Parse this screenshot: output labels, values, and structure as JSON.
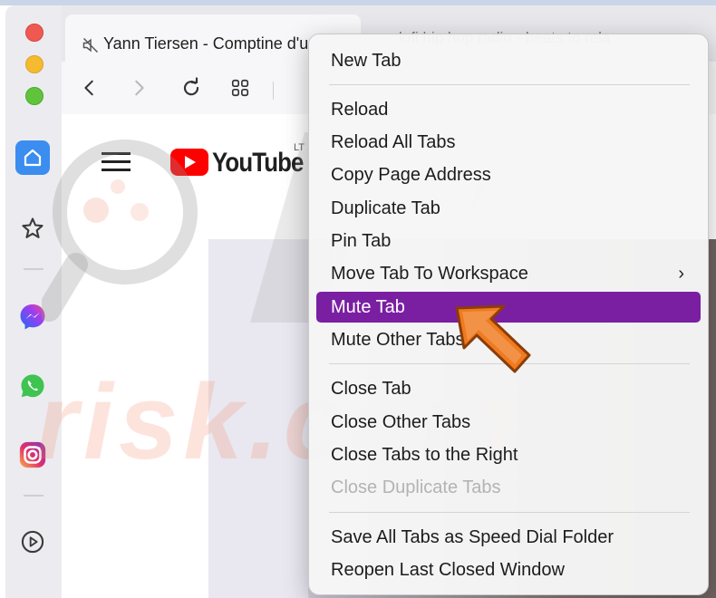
{
  "browser": {
    "tabs": [
      {
        "title": "Yann Tiersen - Comptine d'u",
        "active": true
      },
      {
        "title": "lofi hip hop radio - beats to rela",
        "active": false
      }
    ]
  },
  "page": {
    "logo_text": "YouTube",
    "logo_suffix": "LT"
  },
  "menu": {
    "items": [
      {
        "label": "New Tab"
      },
      {
        "label": "Reload"
      },
      {
        "label": "Reload All Tabs"
      },
      {
        "label": "Copy Page Address"
      },
      {
        "label": "Duplicate Tab"
      },
      {
        "label": "Pin Tab"
      },
      {
        "label": "Move Tab To Workspace",
        "submenu": true
      },
      {
        "label": "Mute Tab",
        "highlighted": true
      },
      {
        "label": "Mute Other Tabs"
      },
      {
        "label": "Close Tab"
      },
      {
        "label": "Close Other Tabs"
      },
      {
        "label": "Close Tabs to the Right"
      },
      {
        "label": "Close Duplicate Tabs",
        "disabled": true
      },
      {
        "label": "Save All Tabs as Speed Dial Folder"
      },
      {
        "label": "Reopen Last Closed Window"
      }
    ],
    "submenu_indicator": "›"
  },
  "watermark": {
    "text": "risk.com",
    "brand": "PC"
  },
  "colors": {
    "menu_highlight": "#7a1fa2",
    "arrow": "#f07a1e",
    "sidebar_home": "#3b8df0",
    "youtube_red": "#ff0000"
  },
  "icons": [
    "home-icon",
    "star-icon",
    "messenger-icon",
    "whatsapp-icon",
    "instagram-icon",
    "play-icon",
    "back-icon",
    "forward-icon",
    "reload-icon",
    "tiles-icon",
    "hamburger-icon",
    "speaker-icon",
    "chevron-right-icon"
  ]
}
